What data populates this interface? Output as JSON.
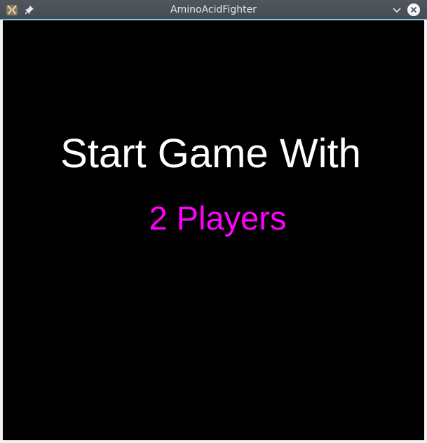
{
  "window": {
    "title": "AminoAcidFighter",
    "app_icon": "amino-acid-fighter-app-icon",
    "pin_icon": "pin-icon",
    "minimize_icon": "chevron-down-icon",
    "close_icon": "close-icon"
  },
  "game": {
    "heading": "Start Game With",
    "selected_option": "2 Players",
    "colors": {
      "background": "#000000",
      "heading": "#ffffff",
      "option": "#ff00ff",
      "titlebar": "#4a5057",
      "focus_border": "#3daee9"
    }
  }
}
